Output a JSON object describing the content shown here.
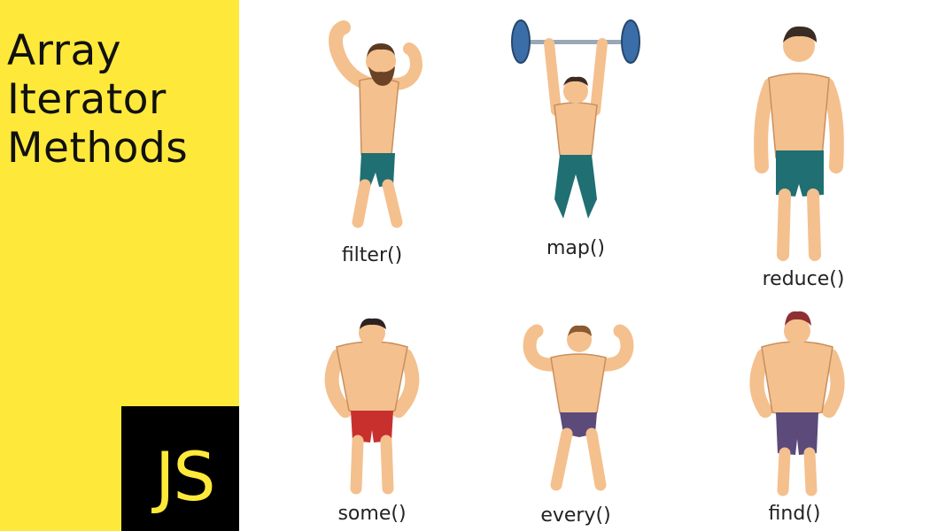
{
  "title": {
    "line1": "Array",
    "line2": "Iterator",
    "line3": "Methods"
  },
  "logo": {
    "text": "JS"
  },
  "colors": {
    "panel": "#fee93a",
    "logo_bg": "#000000",
    "skin": "#f4c08e",
    "teal_shorts": "#1f6f73",
    "red_shorts": "#c8302e",
    "purple_shorts": "#5b4a7a"
  },
  "methods": [
    {
      "label": "filter()",
      "figure": "bearded-flexing-man-icon"
    },
    {
      "label": "map()",
      "figure": "weightlifter-barbell-icon"
    },
    {
      "label": "reduce()",
      "figure": "standing-muscular-man-icon"
    },
    {
      "label": "some()",
      "figure": "muscular-man-hands-on-hips-icon"
    },
    {
      "label": "every()",
      "figure": "double-biceps-pose-icon"
    },
    {
      "label": "find()",
      "figure": "muscular-man-purple-shorts-icon"
    }
  ]
}
